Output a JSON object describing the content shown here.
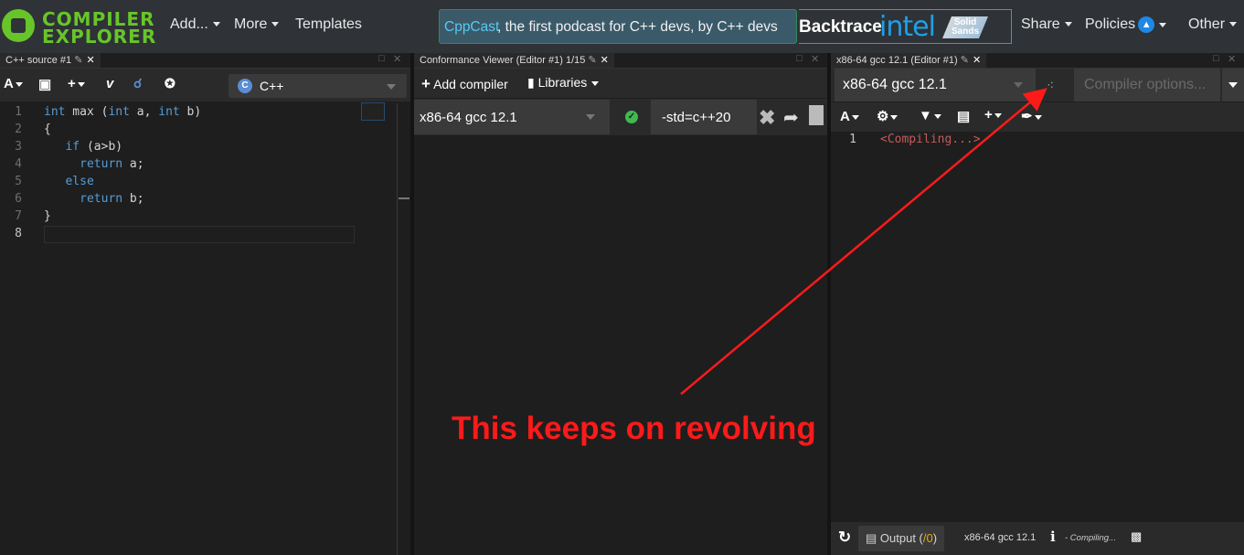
{
  "nav": {
    "logo_line1": "COMPILER",
    "logo_line2": "EXPLORER",
    "add_label": "Add...",
    "more_label": "More",
    "templates_label": "Templates",
    "podcast_link": "CppCast",
    "podcast_text": ", the first podcast for C++ devs, by C++ devs",
    "sponsor1": "Backtrace",
    "sponsor2": "intel",
    "sponsor3": "Solid Sands",
    "share_label": "Share",
    "policies_label": "Policies",
    "other_label": "Other"
  },
  "source_pane": {
    "tab_title": "C++ source #1",
    "language": "C++",
    "lines": [
      {
        "n": "1",
        "segments": [
          {
            "t": "int",
            "k": true
          },
          {
            "t": " max (",
            "k": false
          },
          {
            "t": "int",
            "k": true
          },
          {
            "t": " a, ",
            "k": false
          },
          {
            "t": "int",
            "k": true
          },
          {
            "t": " b)",
            "k": false
          }
        ]
      },
      {
        "n": "2",
        "segments": [
          {
            "t": "{",
            "k": false
          }
        ]
      },
      {
        "n": "3",
        "segments": [
          {
            "t": "   ",
            "k": false
          },
          {
            "t": "if",
            "k": true
          },
          {
            "t": " (a>b)",
            "k": false
          }
        ]
      },
      {
        "n": "4",
        "segments": [
          {
            "t": "     ",
            "k": false
          },
          {
            "t": "return",
            "k": true
          },
          {
            "t": " a;",
            "k": false
          }
        ]
      },
      {
        "n": "5",
        "segments": [
          {
            "t": "   ",
            "k": false
          },
          {
            "t": "else",
            "k": true
          }
        ]
      },
      {
        "n": "6",
        "segments": [
          {
            "t": "     ",
            "k": false
          },
          {
            "t": "return",
            "k": true
          },
          {
            "t": " b;",
            "k": false
          }
        ]
      },
      {
        "n": "7",
        "segments": [
          {
            "t": "}",
            "k": false
          }
        ]
      },
      {
        "n": "8",
        "segments": []
      }
    ]
  },
  "conformance_pane": {
    "tab_title": "Conformance Viewer (Editor #1) 1/15",
    "add_compiler": "Add compiler",
    "libraries": "Libraries",
    "compiler": "x86-64 gcc 12.1",
    "options": "-std=c++20"
  },
  "compiler_pane": {
    "tab_title": "x86-64 gcc 12.1 (Editor #1)",
    "compiler": "x86-64 gcc 12.1",
    "options_placeholder": "Compiler options...",
    "line_no": "1",
    "compiling_text": "<Compiling...>",
    "output_label": "Output (",
    "output_count": "/0",
    "output_close": ")",
    "status_compiler": "x86-64 gcc 12.1",
    "status_text": "- Compiling..."
  },
  "annotation": {
    "text": "This keeps on revolving",
    "color": "#ff1a1a"
  },
  "colors": {
    "logo_green": "#67c52a",
    "keyword_blue": "#569cd6",
    "check_green": "#3fb950",
    "compiling_red": "#c55a5a"
  }
}
